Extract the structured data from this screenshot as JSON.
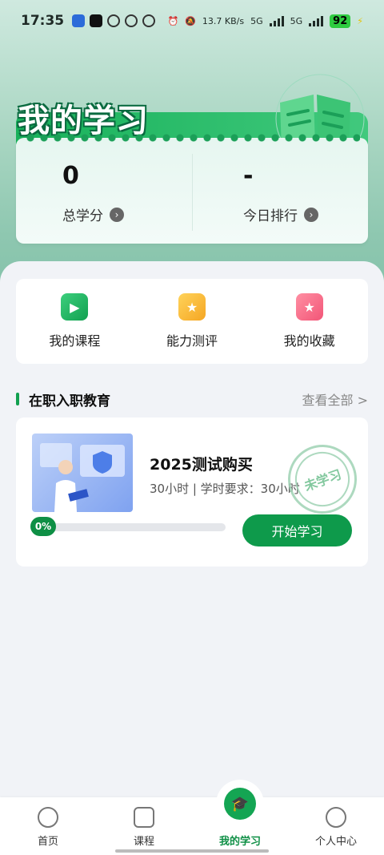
{
  "status_bar": {
    "time": "17:35",
    "net_speed": "13.7 KB/s",
    "net_type_1": "5G",
    "net_type_2": "5G",
    "battery": "92"
  },
  "header": {
    "title": "我的学习",
    "stats": [
      {
        "value": "0",
        "label": "总学分"
      },
      {
        "value": "-",
        "label": "今日排行"
      }
    ]
  },
  "quick_links": [
    {
      "label": "我的课程",
      "icon": "play-video-icon"
    },
    {
      "label": "能力测评",
      "icon": "assessment-icon"
    },
    {
      "label": "我的收藏",
      "icon": "star-folder-icon"
    }
  ],
  "section": {
    "title": "在职入职教育",
    "view_all": "查看全部 >"
  },
  "course": {
    "title": "2025测试购买",
    "meta": "30小时 | 学时要求：30小时",
    "stamp": "未学习",
    "progress_label": "0%",
    "progress": 0,
    "action": "开始学习"
  },
  "tabbar": {
    "items": [
      {
        "label": "首页"
      },
      {
        "label": "课程"
      },
      {
        "label": "我的学习",
        "active": true
      },
      {
        "label": "个人中心"
      }
    ]
  },
  "colors": {
    "accent": "#0e9a4b"
  }
}
